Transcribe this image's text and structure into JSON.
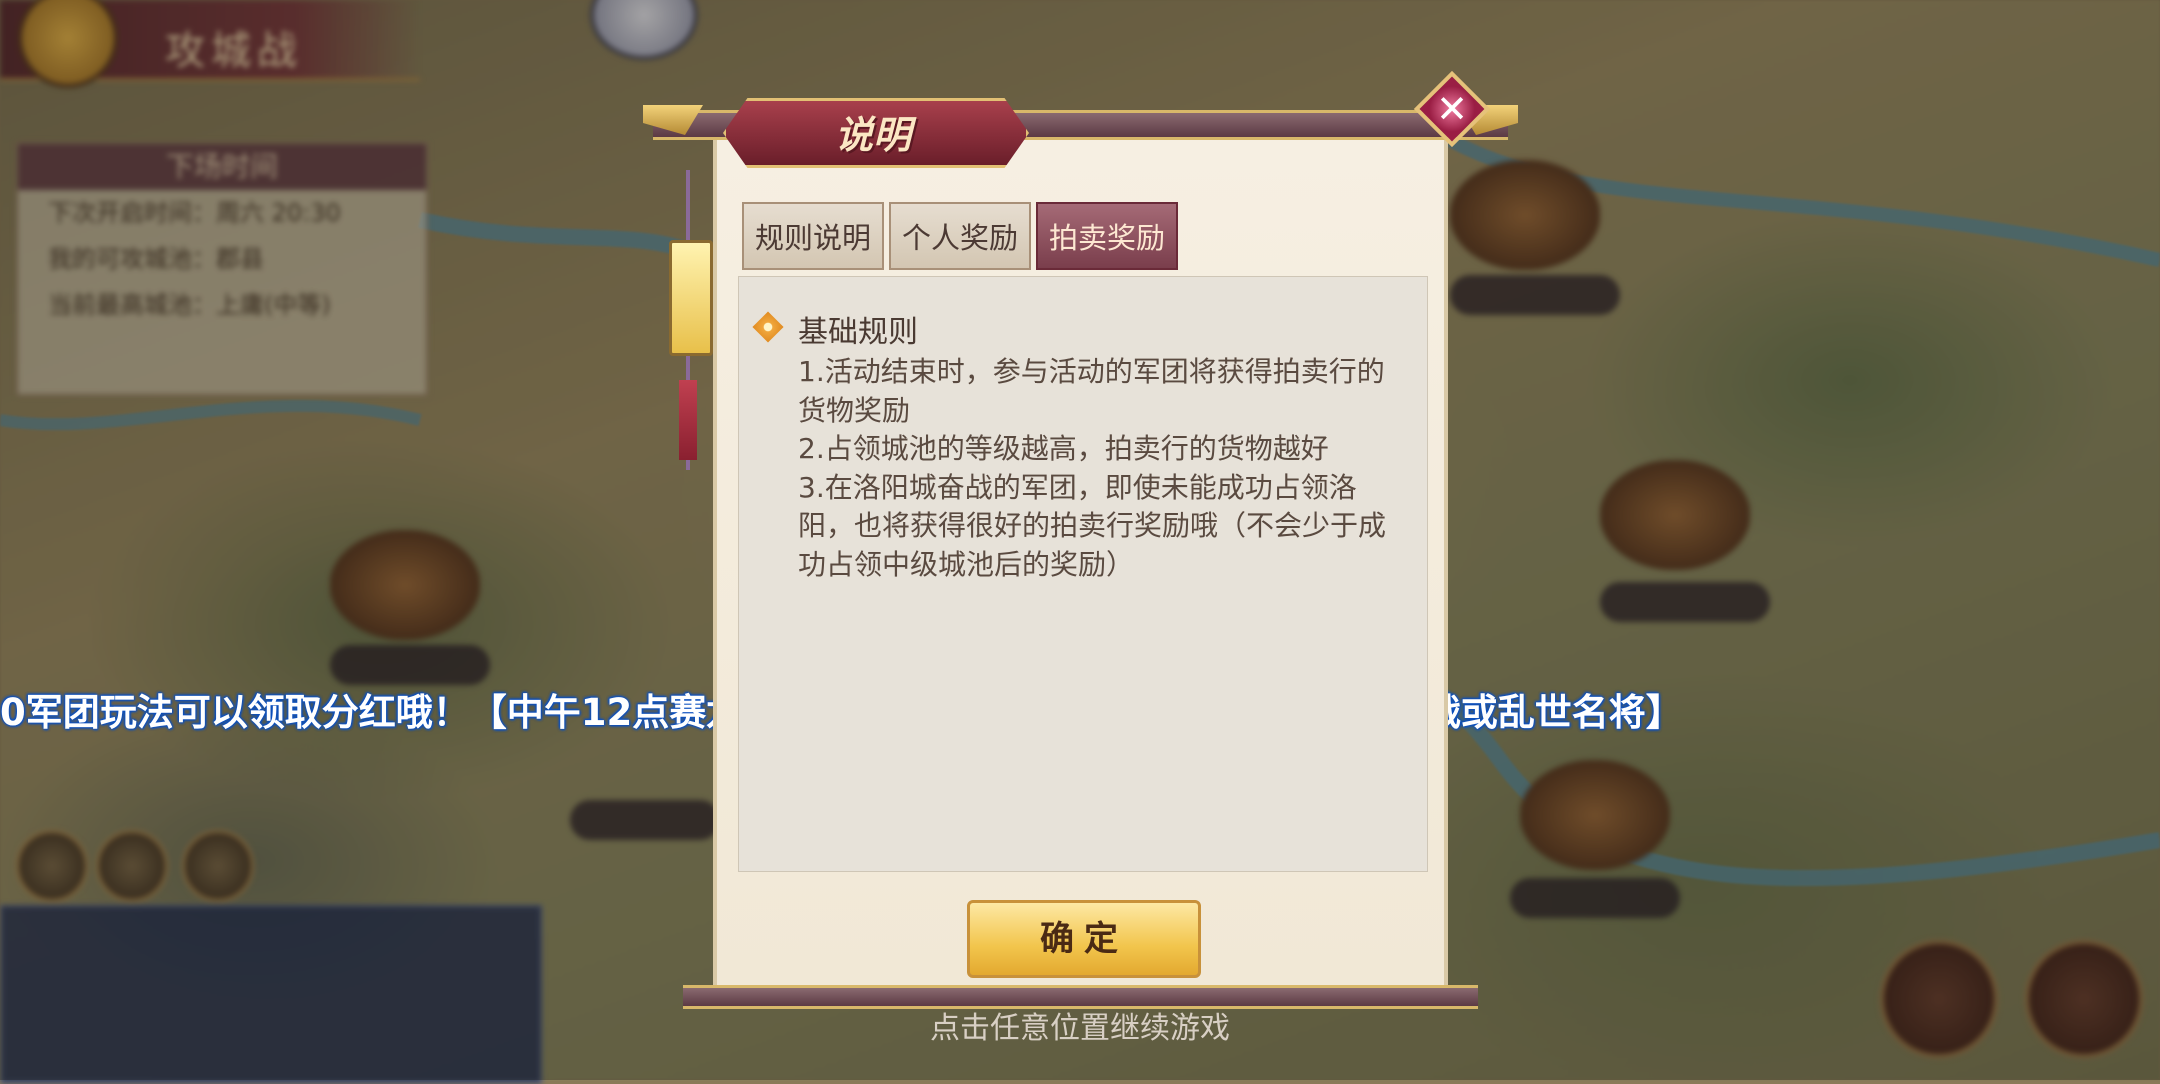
{
  "hud": {
    "mode_title": "攻城战"
  },
  "info_panel": {
    "header": "下场时间",
    "rows": [
      "下次开启时间：周六 20:30",
      "我的可攻城池：郡县",
      "当前最高城池：上庸(中等)"
    ]
  },
  "marquee": {
    "text": "0军团玩法可以领取分红哦！【中午12点赛龙舟】【晚上8点世界魔将】【晚上8点半攻城战或乱世名将】"
  },
  "dialog": {
    "title": "说明",
    "close_symbol": "✕",
    "tabs": [
      {
        "label": "规则说明",
        "active": false
      },
      {
        "label": "个人奖励",
        "active": false
      },
      {
        "label": "拍卖奖励",
        "active": true
      }
    ],
    "section_title": "基础规则",
    "rules": [
      "1.活动结束时，参与活动的军团将获得拍卖行的货物奖励",
      "2.占领城池的等级越高，拍卖行的货物越好",
      "3.在洛阳城奋战的军团，即使未能成功占领洛阳，也将获得很好的拍卖行奖励哦（不会少于成功占领中级城池后的奖励）"
    ],
    "confirm_label": "确定"
  },
  "continue_hint": "点击任意位置继续游戏",
  "colors": {
    "accent_wine": "#7a3e4c",
    "gold_button": "#f2c54c",
    "marquee_glow": "#0a4fc0"
  }
}
